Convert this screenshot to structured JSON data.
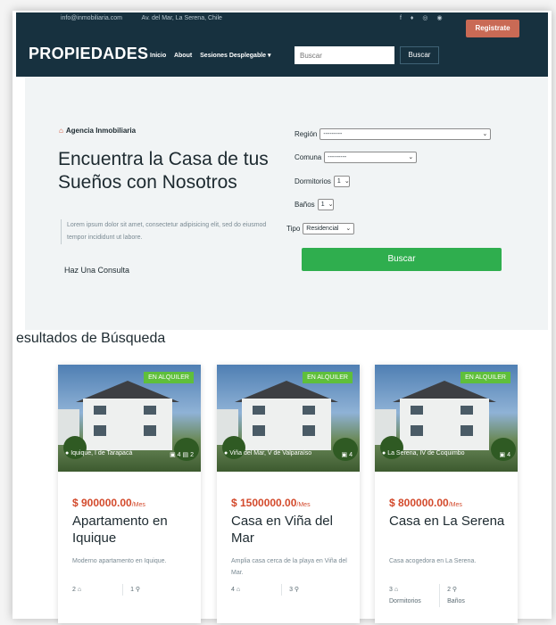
{
  "header": {
    "email": "info@inmobiliaria.com",
    "address": "Av. del Mar, La Serena, Chile",
    "social_icons": "f ♦ ◎ ◉",
    "register_label": "Registrate",
    "brand": "PROPIEDADES",
    "nav": [
      "Inicio",
      "About",
      "Sesiones Desplegable ▾"
    ],
    "search_placeholder": "Buscar",
    "search_button": "Buscar"
  },
  "hero": {
    "agency_label": "Agencia Inmobiliaria",
    "headline": "Encuentra la Casa de tus Sueños con Nosotros",
    "lorem": "Lorem ipsum dolor sit amet, consectetur adipisicing elit, sed do eiusmod tempor incididunt ut labore.",
    "consult_link": "Haz Una Consulta"
  },
  "search_form": {
    "region_label": "Región",
    "region_value": "---------",
    "comuna_label": "Comuna",
    "comuna_value": "---------",
    "bedrooms_label": "Dormitorios",
    "bedrooms_value": "1",
    "bathrooms_label": "Baños",
    "bathrooms_value": "1",
    "type_label": "Tipo",
    "type_value": "Residencial",
    "submit_label": "Buscar"
  },
  "results": {
    "title": "esultados de Búsqueda",
    "cards": [
      {
        "badge": "EN ALQUILER",
        "location": "Iquique, I de Tarapacá",
        "photos": "4",
        "rooms_icon_count": "2",
        "price": "$ 900000.00",
        "per": "/Mes",
        "title": "Apartamento en Iquique",
        "description": "Moderno apartamento en Iquique.",
        "bedrooms": "2 ⌂",
        "bathrooms": "1 ⚲",
        "bedrooms_label": "",
        "bathrooms_label": ""
      },
      {
        "badge": "EN ALQUILER",
        "location": "Viña del Mar, V de Valparaíso",
        "photos": "4",
        "rooms_icon_count": "",
        "price": "$ 1500000.00",
        "per": "/Mes",
        "title": "Casa en Viña del Mar",
        "description": "Amplia casa cerca de la playa en Viña del Mar.",
        "bedrooms": "4 ⌂",
        "bathrooms": "3 ⚲",
        "bedrooms_label": "",
        "bathrooms_label": ""
      },
      {
        "badge": "EN ALQUILER",
        "location": "La Serena, IV de Coquimbo",
        "photos": "4",
        "rooms_icon_count": "",
        "price": "$ 800000.00",
        "per": "/Mes",
        "title": "Casa en La Serena",
        "description": "Casa acogedora en La Serena.",
        "bedrooms": "3 ⌂",
        "bathrooms": "2 ⚲",
        "bedrooms_label": "Dormitorios",
        "bathrooms_label": "Baños"
      }
    ]
  },
  "colors": {
    "nav_bg": "#17313f",
    "accent_red": "#d34a2c",
    "search_green": "#2fae4e",
    "badge_green": "#5fbf3b"
  }
}
